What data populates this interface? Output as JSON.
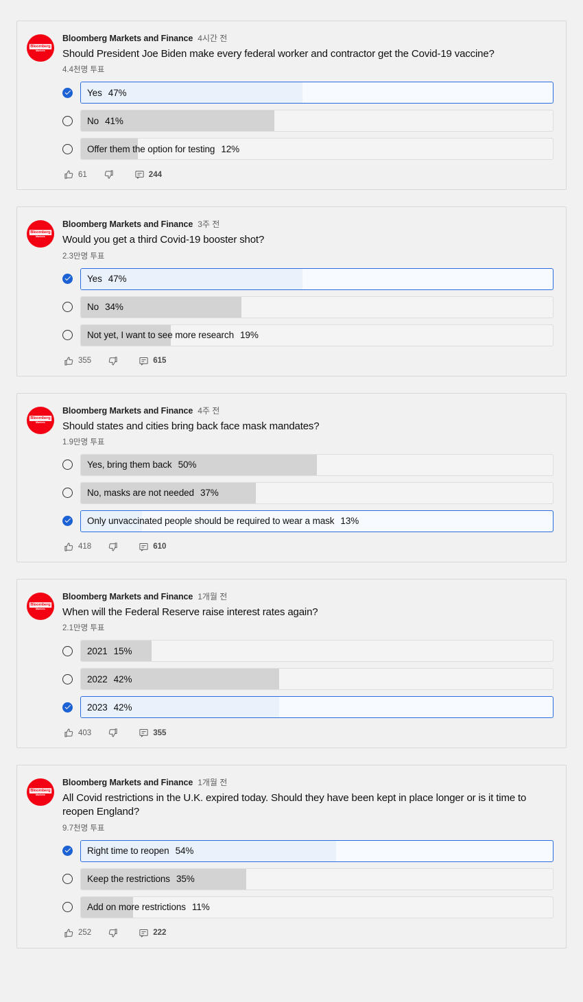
{
  "channel": {
    "name": "Bloomberg Markets and Finance",
    "avatar_icon": "bloomberg-logo-icon",
    "avatar_line1": "Bloomberg",
    "avatar_line2": "Markets",
    "avatar_color": "#f40013"
  },
  "icons": {
    "like": "thumbs-up-icon",
    "dislike": "thumbs-down-icon",
    "comment": "comment-icon",
    "checked": "check-circle-icon",
    "unchecked": "radio-unchecked-icon"
  },
  "colors": {
    "accent": "#1c62d4",
    "selected_border": "#2a6ce0",
    "selected_fill": "#e9f1fb",
    "bar_fill": "#d3d3d3",
    "track_bg": "#f4f4f4",
    "page_bg": "#f1f1f1"
  },
  "polls": [
    {
      "channel": "Bloomberg Markets and Finance",
      "timestamp": "4시간 전",
      "question": "Should President Joe Biden make every federal worker and contractor get the Covid-19 vaccine?",
      "votes": "4.4천명 투표",
      "options": [
        {
          "label": "Yes",
          "percent": "47%",
          "value": 47,
          "selected": true
        },
        {
          "label": "No",
          "percent": "41%",
          "value": 41,
          "selected": false
        },
        {
          "label": "Offer them the option for testing",
          "percent": "12%",
          "value": 12,
          "selected": false
        }
      ],
      "likes": "61",
      "dislikes": "",
      "comments": "244"
    },
    {
      "channel": "Bloomberg Markets and Finance",
      "timestamp": "3주 전",
      "question": "Would you get a third Covid-19 booster shot?",
      "votes": "2.3만명 투표",
      "options": [
        {
          "label": "Yes",
          "percent": "47%",
          "value": 47,
          "selected": true
        },
        {
          "label": "No",
          "percent": "34%",
          "value": 34,
          "selected": false
        },
        {
          "label": "Not yet, I want to see more research",
          "percent": "19%",
          "value": 19,
          "selected": false
        }
      ],
      "likes": "355",
      "dislikes": "",
      "comments": "615"
    },
    {
      "channel": "Bloomberg Markets and Finance",
      "timestamp": "4주 전",
      "question": "Should states and cities bring back face mask mandates?",
      "votes": "1.9만명 투표",
      "options": [
        {
          "label": "Yes, bring them back",
          "percent": "50%",
          "value": 50,
          "selected": false
        },
        {
          "label": "No, masks are not needed",
          "percent": "37%",
          "value": 37,
          "selected": false
        },
        {
          "label": "Only unvaccinated people should be required to wear a mask",
          "percent": "13%",
          "value": 13,
          "selected": true
        }
      ],
      "likes": "418",
      "dislikes": "",
      "comments": "610"
    },
    {
      "channel": "Bloomberg Markets and Finance",
      "timestamp": "1개월 전",
      "question": "When will the Federal Reserve raise interest rates again?",
      "votes": "2.1만명 투표",
      "options": [
        {
          "label": "2021",
          "percent": "15%",
          "value": 15,
          "selected": false
        },
        {
          "label": "2022",
          "percent": "42%",
          "value": 42,
          "selected": false
        },
        {
          "label": "2023",
          "percent": "42%",
          "value": 42,
          "selected": true
        }
      ],
      "likes": "403",
      "dislikes": "",
      "comments": "355"
    },
    {
      "channel": "Bloomberg Markets and Finance",
      "timestamp": "1개월 전",
      "question": "All Covid restrictions in the U.K. expired today. Should they have been kept in place longer or is it time to reopen England?",
      "votes": "9.7천명 투표",
      "options": [
        {
          "label": "Right time to reopen",
          "percent": "54%",
          "value": 54,
          "selected": true
        },
        {
          "label": "Keep the restrictions",
          "percent": "35%",
          "value": 35,
          "selected": false
        },
        {
          "label": "Add on more restrictions",
          "percent": "11%",
          "value": 11,
          "selected": false
        }
      ],
      "likes": "252",
      "dislikes": "",
      "comments": "222"
    }
  ]
}
